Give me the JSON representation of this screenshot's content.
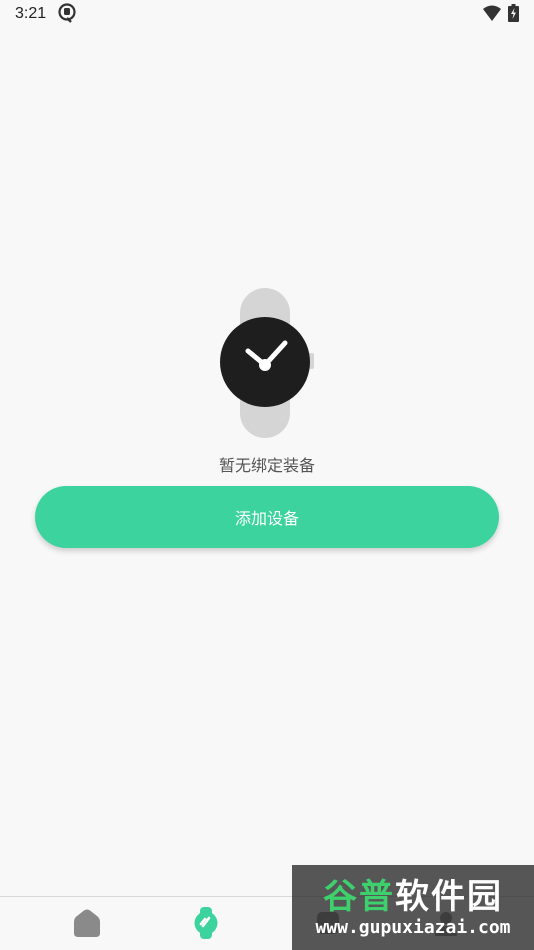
{
  "status_bar": {
    "time": "3:21",
    "app_icon": "notification-app-icon",
    "wifi_icon": "wifi-icon",
    "battery_icon": "battery-charging-icon"
  },
  "empty_state": {
    "illustration_icon": "smartwatch-icon",
    "message": "暂无绑定装备"
  },
  "actions": {
    "add_device_label": "添加设备"
  },
  "bottom_nav": {
    "items": [
      {
        "icon": "home-icon",
        "active": false
      },
      {
        "icon": "watch-icon",
        "active": true
      },
      {
        "icon": "data-icon",
        "active": false
      },
      {
        "icon": "profile-icon",
        "active": false
      }
    ]
  },
  "watermark": {
    "title_green": "谷普",
    "title_white": "软件园",
    "url": "www.gupuxiazai.com"
  },
  "colors": {
    "accent": "#3cd39f",
    "background": "#f8f8f8",
    "watch_face": "#1e1e1e",
    "watch_band": "#d5d5d5"
  }
}
